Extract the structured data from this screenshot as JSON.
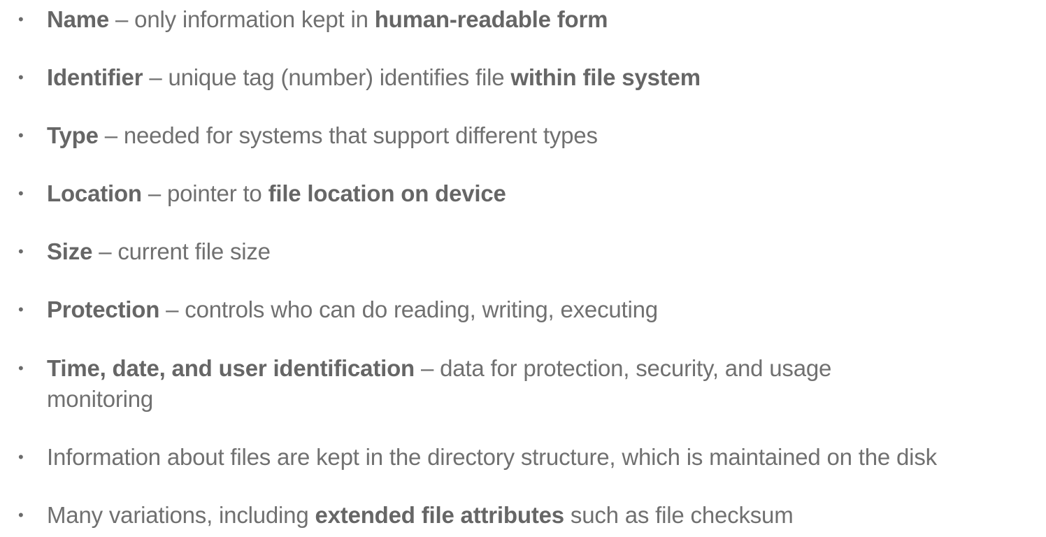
{
  "bullets": [
    {
      "segments": [
        {
          "text": "Name",
          "bold": true
        },
        {
          "text": " – only information kept in ",
          "bold": false
        },
        {
          "text": "human-readable form",
          "bold": true
        }
      ]
    },
    {
      "segments": [
        {
          "text": "Identifier",
          "bold": true
        },
        {
          "text": " – unique tag (number) identifies file ",
          "bold": false
        },
        {
          "text": "within file system",
          "bold": true
        }
      ]
    },
    {
      "segments": [
        {
          "text": "Type",
          "bold": true
        },
        {
          "text": " – needed for systems that support different types",
          "bold": false
        }
      ]
    },
    {
      "segments": [
        {
          "text": "Location",
          "bold": true
        },
        {
          "text": " – pointer to ",
          "bold": false
        },
        {
          "text": "file location on device",
          "bold": true
        }
      ]
    },
    {
      "segments": [
        {
          "text": "Size",
          "bold": true
        },
        {
          "text": " – current file size",
          "bold": false
        }
      ]
    },
    {
      "segments": [
        {
          "text": "Protection",
          "bold": true
        },
        {
          "text": " – controls who can do reading, writing, executing",
          "bold": false
        }
      ]
    },
    {
      "segments": [
        {
          "text": "Time, date, and user identification",
          "bold": true
        },
        {
          "text": " – data for protection, security, and usage monitoring",
          "bold": false
        }
      ]
    },
    {
      "segments": [
        {
          "text": "Information about files are kept in the directory structure, which is maintained on the disk",
          "bold": false
        }
      ]
    },
    {
      "segments": [
        {
          "text": "Many variations, including ",
          "bold": false
        },
        {
          "text": "extended file attributes",
          "bold": true
        },
        {
          "text": " such as file checksum",
          "bold": false
        }
      ]
    }
  ],
  "bullet_glyph": "•"
}
